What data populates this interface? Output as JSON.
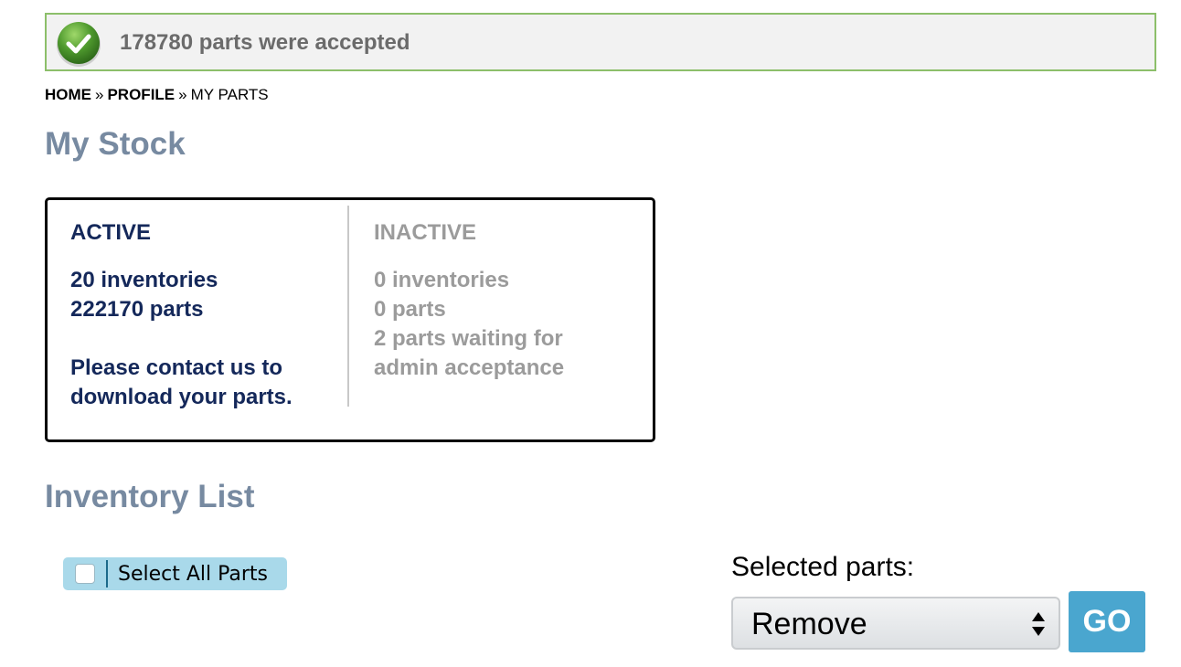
{
  "notice": {
    "message": "178780 parts were accepted",
    "icon": "check-circle-icon",
    "border_color": "#8cbf6a"
  },
  "breadcrumb": {
    "home": "HOME",
    "profile": "PROFILE",
    "current": "MY PARTS",
    "separator": "»"
  },
  "stock": {
    "title": "My Stock",
    "active": {
      "heading": "ACTIVE",
      "inventories": "20 inventories",
      "parts": "222170 parts",
      "note_line1": "Please contact us to",
      "note_line2": "download your parts.",
      "color": "#14285a"
    },
    "inactive": {
      "heading": "INACTIVE",
      "inventories": "0 inventories",
      "parts": "0 parts",
      "waiting_line1": "2 parts waiting for",
      "waiting_line2": "admin acceptance",
      "color": "#9b9b9b"
    }
  },
  "inventory": {
    "title": "Inventory List",
    "select_all_label": "Select All Parts",
    "select_all_checked": false,
    "selected_parts_label": "Selected parts:",
    "action_selected": "Remove",
    "go_label": "GO",
    "accent_color": "#4aa6cf"
  }
}
